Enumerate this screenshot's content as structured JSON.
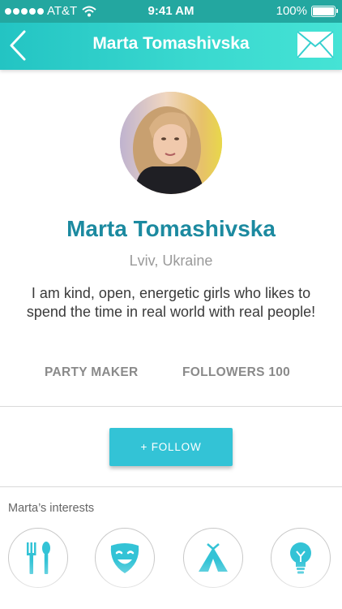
{
  "status_bar": {
    "carrier": "AT&T",
    "time": "9:41 AM",
    "battery": "100%"
  },
  "nav": {
    "title": "Marta Tomashivska",
    "back_icon": "chevron-left-icon",
    "mail_icon": "envelope-icon"
  },
  "profile": {
    "name": "Marta Tomashivska",
    "location": "Lviv, Ukraine",
    "bio": "I am kind, open, energetic girls who likes to spend the time in real world with real people!",
    "role": "PARTY MAKER",
    "followers_label": "FOLLOWERS 100"
  },
  "follow_button": {
    "label": "+ FOLLOW"
  },
  "interests": {
    "title": "Marta’s interests",
    "items": [
      {
        "icon": "food-icon"
      },
      {
        "icon": "theater-mask-icon"
      },
      {
        "icon": "camping-tent-icon"
      },
      {
        "icon": "lightbulb-icon"
      }
    ]
  },
  "colors": {
    "accent": "#33c3d6",
    "name": "#1c8aa0",
    "header_start": "#23c4c3",
    "header_end": "#45e3d5"
  }
}
